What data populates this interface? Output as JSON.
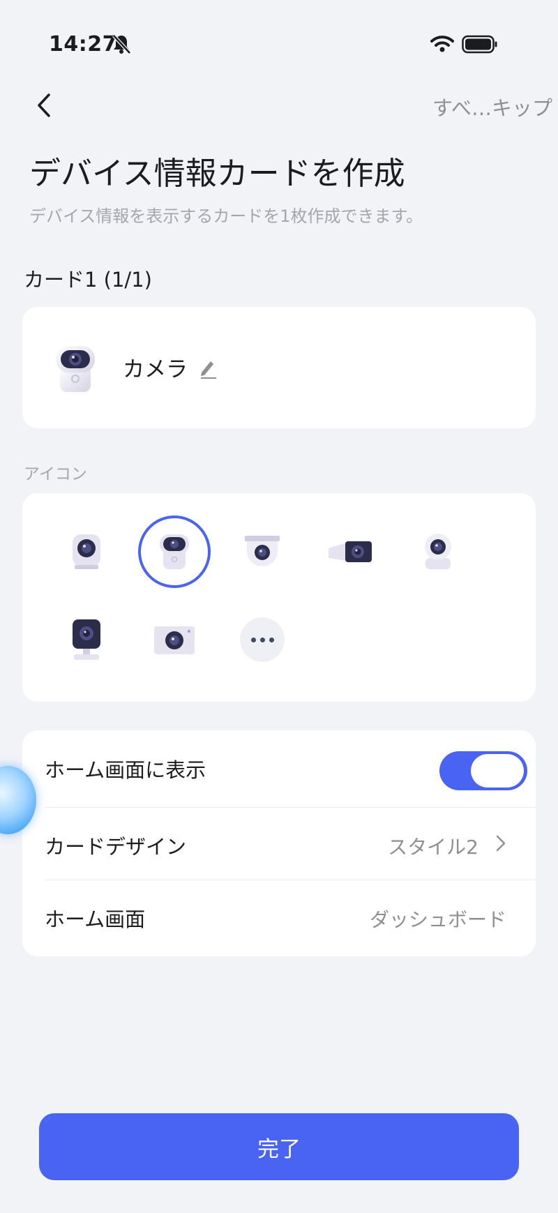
{
  "status_bar": {
    "time": "14:27",
    "icons": [
      "bell-slash-icon",
      "wifi-icon",
      "battery-icon"
    ]
  },
  "nav": {
    "back_icon": "chevron-left-icon",
    "skip_label": "すべ…キップ"
  },
  "header": {
    "title": "デバイス情報カードを作成",
    "subtitle": "デバイス情報を表示するカードを1枚作成できます。"
  },
  "card_section_label": "カード1 (1/1)",
  "preview_card": {
    "name": "カメラ",
    "icon": "camera-robot-icon",
    "edit_icon": "pencil-icon"
  },
  "icon_section": {
    "label": "アイコン",
    "selected_index": 1,
    "icons": [
      "cube-camera-icon",
      "robot-camera-icon",
      "dome-camera-icon",
      "bullet-camera-icon",
      "ptz-camera-icon",
      "stand-camera-icon",
      "box-camera-icon",
      "more-icon"
    ]
  },
  "settings": {
    "show_on_home": {
      "label": "ホーム画面に表示",
      "enabled": true
    },
    "card_design": {
      "label": "カードデザイン",
      "value": "スタイル2"
    },
    "home_screen": {
      "label": "ホーム画面",
      "value": "ダッシュボード"
    }
  },
  "done_button": {
    "label": "完了"
  },
  "colors": {
    "accent": "#4964f3",
    "background": "#f2f3f7",
    "panel": "#ffffff",
    "secondary_text": "#8e8e93"
  }
}
